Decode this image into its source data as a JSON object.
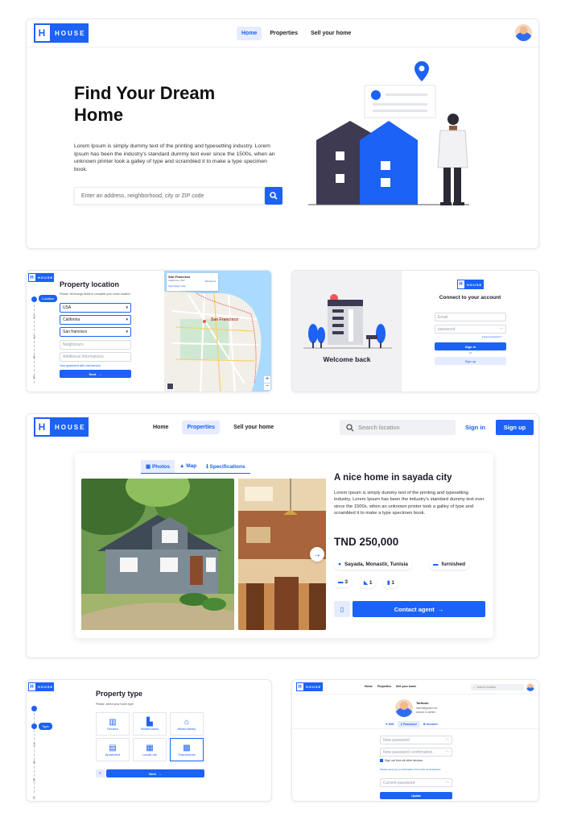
{
  "brand": {
    "name": "HOUSE"
  },
  "colors": {
    "primary": "#1b62f5",
    "dark": "#3d3a52"
  },
  "hero": {
    "nav": [
      "Home",
      "Properties",
      "Sell your home"
    ],
    "title_line1": "Find Your Dream",
    "title_line2": "Home",
    "description": "Lorem Ipsum is simply dummy text of the printing and typesetting industry. Lorem Ipsum has been the industry's standard dummy text ever since the 1500s, when an unknown printer took a galley of type and scrambled it to make a type specimen book.",
    "search_placeholder": "Enter an address, neighborhood, city or ZIP code",
    "search_icon": "search-icon"
  },
  "property_location": {
    "title": "Property location",
    "subtitle": "Please, fat throngs fields to complete your home location",
    "step_label": "Location",
    "steps": [
      "1",
      "2",
      "3",
      "4",
      "5",
      "6"
    ],
    "fields": [
      {
        "label": "Country",
        "value": "USA"
      },
      {
        "label": "State",
        "value": "California"
      },
      {
        "label": "City",
        "value": "San francisco"
      },
      {
        "label": "",
        "value": "Neighbours"
      },
      {
        "label": "",
        "value": "Additional Informations"
      }
    ],
    "link": "Your apartment with chat service",
    "next_button": "Next",
    "map_card": {
      "title": "San Francisco",
      "subtitle": "California, USA",
      "link": "View larger map",
      "directions": "Directions"
    },
    "map_city_label": "San Francisco"
  },
  "login": {
    "welcome": "Welcome back",
    "heading": "Connect to your account",
    "email_placeholder": "Email",
    "password_placeholder": "password",
    "forgot": "Forgot password ?",
    "signin_button": "Sign in",
    "or": "or",
    "signup_button": "Sign up"
  },
  "listing": {
    "nav": [
      "Home",
      "Properties",
      "Sell your home"
    ],
    "search_placeholder": "Search location",
    "signin": "Sign in",
    "signup": "Sign up",
    "tabs": [
      "Photos",
      "Map",
      "Specifications"
    ],
    "title": "A nice home in sayada city",
    "description": "Lorem Ipsum is simply dummy text of the printing and typesetting industry. Lorem Ipsum has been the industry's standard dummy text ever since the 1500s, when an unknown printer took a galley of type and scrambled it to make a type specimen book.",
    "price": "TND 250,000",
    "location": "Sayada, Monastir, Tunisia",
    "furnished": "furnished",
    "beds": "3",
    "baths": "1",
    "floors": "1",
    "contact_button": "Contact agent"
  },
  "property_type": {
    "title": "Property type",
    "subtitle": "Please, select your home type",
    "step_label": "Type",
    "steps": [
      "1",
      "2",
      "3",
      "4",
      "5",
      "6"
    ],
    "types": [
      {
        "label": "Houses",
        "icon": "house-icon"
      },
      {
        "label": "Warehouses",
        "icon": "warehouse-icon"
      },
      {
        "label": "Mixed-family",
        "icon": "home-icon"
      },
      {
        "label": "Apartment",
        "icon": "apartment-icon"
      },
      {
        "label": "Land/Lots",
        "icon": "map-icon"
      },
      {
        "label": "Townhomes",
        "icon": "townhome-icon"
      }
    ],
    "back": "<",
    "next_button": "Next"
  },
  "profile": {
    "nav": [
      "Home",
      "Properties",
      "Sell your home"
    ],
    "search_placeholder": "Search location",
    "name": "Tarfaoui",
    "handle": "hamdi@gmail.com",
    "location": "sousse & sahline",
    "tabs": [
      "Edit",
      "Password",
      "Account"
    ],
    "fields": [
      "New password",
      "New password confirmation"
    ],
    "checkbox": "Sign out from all other devices",
    "note": "Please send you a confirmation link to this email address",
    "current": "Current password",
    "update_button": "Update"
  }
}
